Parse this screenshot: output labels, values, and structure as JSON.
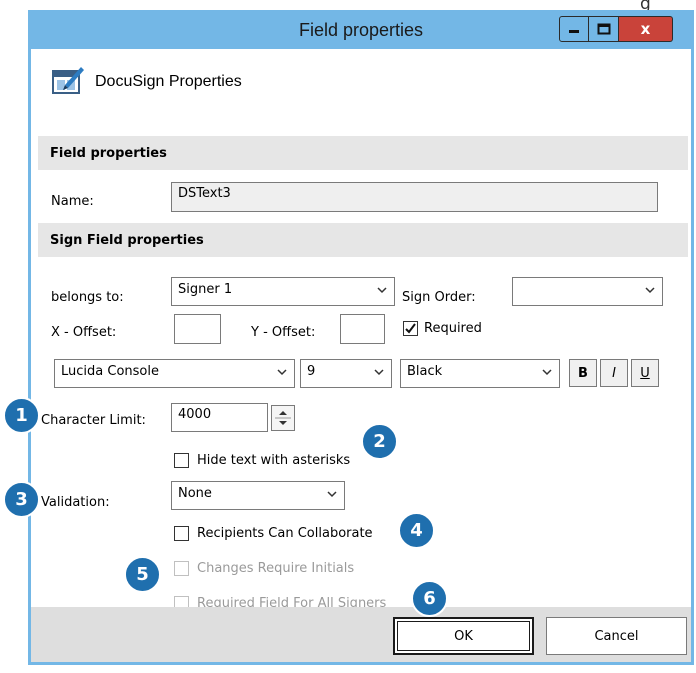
{
  "corner_text": "g",
  "window": {
    "title": "Field properties",
    "controls": {
      "minimize": "minimize",
      "maximize": "maximize",
      "close": "x"
    }
  },
  "header": {
    "title": "DocuSign Properties",
    "icon": "docusign-properties-icon"
  },
  "field_section": {
    "title": "Field properties",
    "name_label": "Name:",
    "name_value": "DSText3"
  },
  "sign_section": {
    "title": "Sign Field properties",
    "belongs_label": "belongs to:",
    "belongs_value": "Signer 1",
    "sign_order_label": "Sign Order:",
    "sign_order_value": "",
    "x_offset_label": "X - Offset:",
    "x_offset_value": "",
    "y_offset_label": "Y - Offset:",
    "y_offset_value": "",
    "required_label": "Required",
    "required_checked": true,
    "font_value": "Lucida Console",
    "size_value": "9",
    "color_value": "Black",
    "bold_label": "B",
    "italic_label": "I",
    "underline_label": "U",
    "char_limit_label": "Character Limit:",
    "char_limit_value": "4000",
    "hide_text_label": "Hide text with asterisks",
    "validation_label": "Validation:",
    "validation_value": "None",
    "collaborate_label": "Recipients Can Collaborate",
    "changes_initials_label": "Changes Require Initials",
    "required_all_label": "Required Field For All Signers"
  },
  "footer": {
    "ok_label": "OK",
    "cancel_label": "Cancel"
  },
  "badges": [
    "1",
    "2",
    "3",
    "4",
    "5",
    "6"
  ],
  "colors": {
    "titlebar": "#73b7e6",
    "close": "#c9433a",
    "badge": "#1f6fae",
    "section": "#e6e6e6"
  }
}
